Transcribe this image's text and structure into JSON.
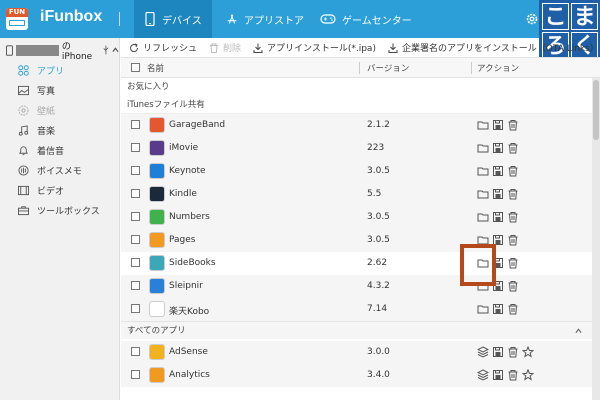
{
  "app": {
    "title": "iFunbox",
    "logo_text": "FUN"
  },
  "nav": {
    "tabs": [
      {
        "label": "デバイス"
      },
      {
        "label": "アプリストア"
      },
      {
        "label": "ゲームセンター"
      }
    ]
  },
  "badge": {
    "chars": [
      "こ",
      "ま",
      "ろ",
      "く"
    ]
  },
  "sidebar": {
    "device": {
      "name": "のiPhone"
    },
    "items": [
      {
        "label": "アプリ",
        "icon": "grid-icon"
      },
      {
        "label": "写真",
        "icon": "photo-icon"
      },
      {
        "label": "壁紙",
        "icon": "wallpaper-icon"
      },
      {
        "label": "音楽",
        "icon": "music-icon"
      },
      {
        "label": "着信音",
        "icon": "bell-icon"
      },
      {
        "label": "ボイスメモ",
        "icon": "voice-memo-icon"
      },
      {
        "label": "ビデオ",
        "icon": "video-icon"
      },
      {
        "label": "ツールボックス",
        "icon": "toolbox-icon"
      }
    ]
  },
  "toolbar": {
    "refresh": "リフレッシュ",
    "delete": "削除",
    "install": "アプリインストール(*.ipa)",
    "enterprise": "企業署名のアプリをインストール（OTA Links）"
  },
  "table": {
    "headers": {
      "name": "名前",
      "version": "バージョン",
      "action": "アクション"
    },
    "sections": {
      "favorites": "お気に入り",
      "itunes": "iTunesファイル共有",
      "all": "すべてのアプリ"
    },
    "itunes_rows": [
      {
        "name": "GarageBand",
        "version": "2.1.2",
        "icon_color": "#e5572f"
      },
      {
        "name": "iMovie",
        "version": "223",
        "icon_color": "#5a3a8c"
      },
      {
        "name": "Keynote",
        "version": "3.0.5",
        "icon_color": "#1f7fd6"
      },
      {
        "name": "Kindle",
        "version": "5.5",
        "icon_color": "#1a2a3a"
      },
      {
        "name": "Numbers",
        "version": "3.0.5",
        "icon_color": "#3fb24b"
      },
      {
        "name": "Pages",
        "version": "3.0.5",
        "icon_color": "#f29a1f"
      },
      {
        "name": "SideBooks",
        "version": "2.62",
        "icon_color": "#3aa8b8"
      },
      {
        "name": "Sleipnir",
        "version": "4.3.2",
        "icon_color": "#2a7fd8"
      },
      {
        "name": "楽天Kobo",
        "version": "7.14",
        "icon_color": "#ffffff"
      }
    ],
    "all_rows": [
      {
        "name": "AdSense",
        "version": "3.0.0",
        "icon_color": "#f2b21f"
      },
      {
        "name": "Analytics",
        "version": "3.4.0",
        "icon_color": "#f29a1f"
      }
    ]
  },
  "colors": {
    "topbar": "#2d9fd8",
    "active_tab": "#1e86bf",
    "highlight_frame": "#b5491b",
    "badge": "#1f5fa8"
  }
}
